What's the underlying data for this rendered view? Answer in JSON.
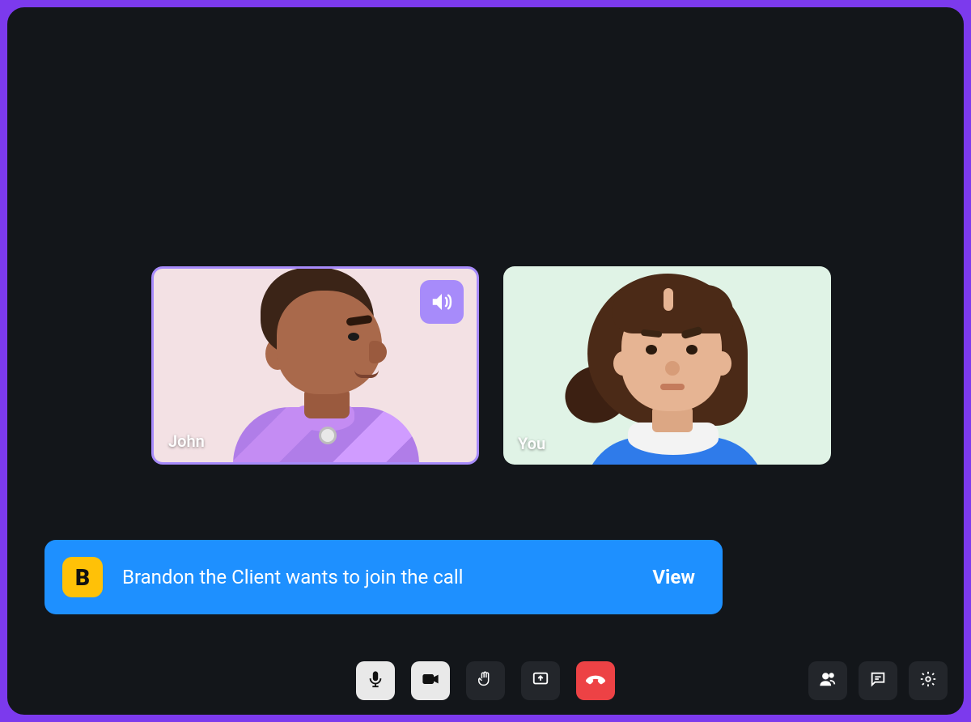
{
  "participants": [
    {
      "name": "John",
      "speaking": true,
      "tile_bg": "#f3e1e4",
      "outfit_color": "#b07de8"
    },
    {
      "name": "You",
      "speaking": false,
      "tile_bg": "#e0f3e6",
      "outfit_color": "#2f7bea"
    }
  ],
  "join_request": {
    "initial": "B",
    "message": "Brandon the Client wants to join the call",
    "action_label": "View"
  },
  "controls": {
    "center": [
      {
        "name": "microphone",
        "style": "light"
      },
      {
        "name": "camera",
        "style": "light"
      },
      {
        "name": "raise-hand",
        "style": "dark"
      },
      {
        "name": "share-screen",
        "style": "dark"
      },
      {
        "name": "end-call",
        "style": "red"
      }
    ],
    "right": [
      {
        "name": "participants",
        "style": "dark"
      },
      {
        "name": "chat",
        "style": "dark"
      },
      {
        "name": "settings",
        "style": "dark"
      }
    ]
  },
  "colors": {
    "accent_border": "#7c3aed",
    "speaker_badge": "#a78bfa",
    "banner": "#1e90ff",
    "avatar_badge": "#ffc107",
    "end_call": "#ed4245"
  }
}
